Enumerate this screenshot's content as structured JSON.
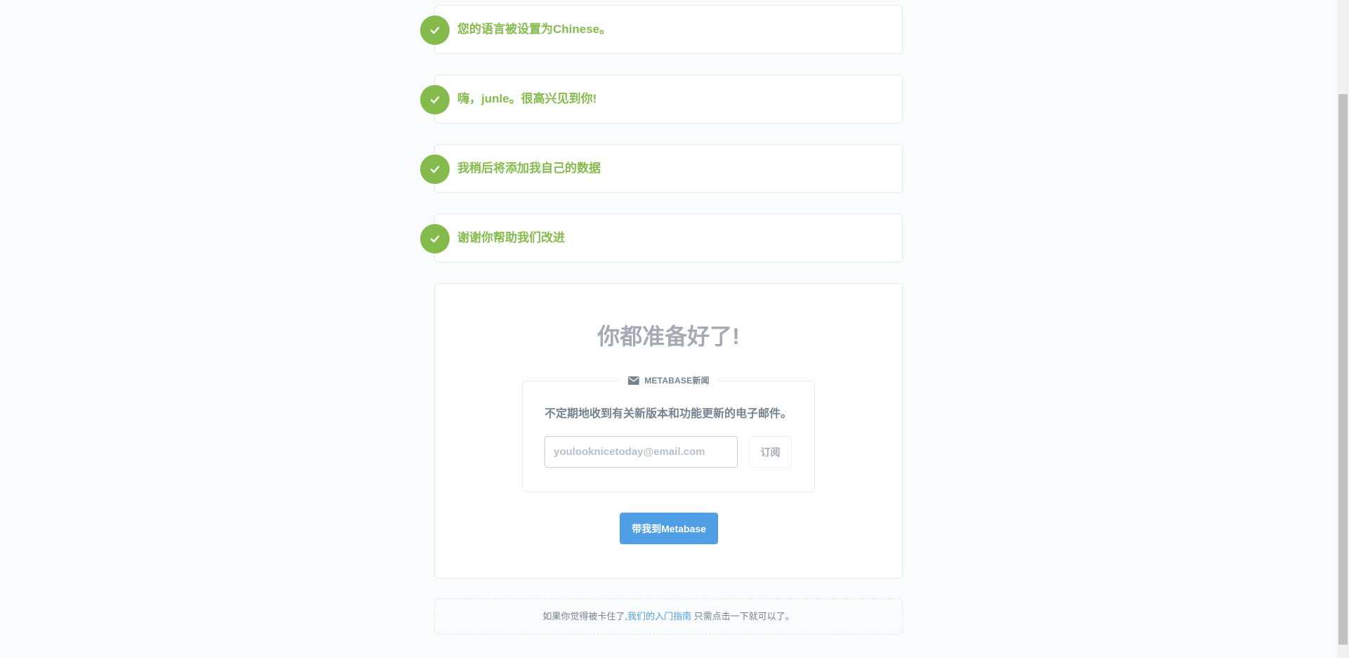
{
  "steps": [
    {
      "label": "您的语言被设置为Chinese。"
    },
    {
      "label": "嗨，junle。很高兴见到你!"
    },
    {
      "label": "我稍后将添加我自己的数据"
    },
    {
      "label": "谢谢你帮助我们改进"
    }
  ],
  "final": {
    "title": "你都准备好了!",
    "newsletter": {
      "legend": "METABASE新闻",
      "description": "不定期地收到有关新版本和功能更新的电子邮件。",
      "email_placeholder": "youlooknicetoday@email.com",
      "subscribe_label": "订阅"
    },
    "go_button_label": "带我到Metabase"
  },
  "help": {
    "prefix": "如果你觉得被卡住了,",
    "link": "我们的入门指南",
    "suffix": " 只需点击一下就可以了。"
  },
  "colors": {
    "success": "#84bb4c",
    "brand": "#509ee3",
    "muted": "#a4aab4",
    "text_medium": "#74838f"
  }
}
